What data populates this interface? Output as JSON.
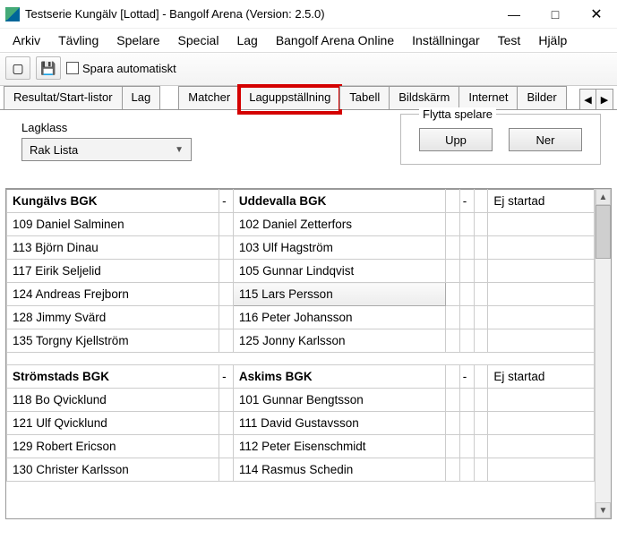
{
  "window": {
    "title": "Testserie Kungälv [Lottad] - Bangolf Arena (Version: 2.5.0)"
  },
  "menu": [
    "Arkiv",
    "Tävling",
    "Spelare",
    "Special",
    "Lag",
    "Bangolf Arena Online",
    "Inställningar",
    "Test",
    "Hjälp"
  ],
  "toolbar": {
    "autosave_label": "Spara automatiskt"
  },
  "tabs": [
    "Resultat/Start-listor",
    "Lag",
    "Matcher",
    "Laguppställning",
    "Tabell",
    "Bildskärm",
    "Internet",
    "Bilder"
  ],
  "panel": {
    "lagklass_label": "Lagklass",
    "lagklass_value": "Rak Lista",
    "move_group": "Flytta spelare",
    "upp": "Upp",
    "ner": "Ner"
  },
  "matches": [
    {
      "home": "Kungälvs BGK",
      "away": "Uddevalla BGK",
      "status": "Ej startad",
      "rows": [
        {
          "h": "109 Daniel Salminen",
          "a": "102 Daniel Zetterfors"
        },
        {
          "h": "113 Björn Dinau",
          "a": "103 Ulf Hagström"
        },
        {
          "h": "117 Eirik Seljelid",
          "a": "105 Gunnar Lindqvist"
        },
        {
          "h": "124 Andreas Frejborn",
          "a": "115 Lars Persson",
          "a_selected": true
        },
        {
          "h": "128 Jimmy Svärd",
          "a": "116 Peter Johansson"
        },
        {
          "h": "135 Torgny Kjellström",
          "a": "125 Jonny Karlsson"
        }
      ]
    },
    {
      "home": "Strömstads BGK",
      "away": "Askims BGK",
      "status": "Ej startad",
      "rows": [
        {
          "h": "118 Bo Qvicklund",
          "a": "101 Gunnar Bengtsson"
        },
        {
          "h": "121 Ulf Qvicklund",
          "a": "111 David Gustavsson"
        },
        {
          "h": "129 Robert Ericson",
          "a": "112 Peter Eisenschmidt"
        },
        {
          "h": "130 Christer Karlsson",
          "a": "114 Rasmus Schedin"
        }
      ]
    }
  ]
}
